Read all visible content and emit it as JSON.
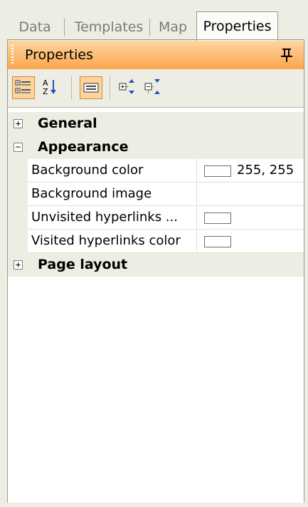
{
  "tabs": [
    {
      "label": "Data"
    },
    {
      "label": "Templates"
    },
    {
      "label": "Map"
    },
    {
      "label": "Properties",
      "active": true
    }
  ],
  "panel": {
    "title": "Properties",
    "pin_icon": "pin-icon",
    "accent_color": "#fba54b"
  },
  "toolbar": {
    "buttons": [
      {
        "name": "categorized-view-button",
        "icon": "categorized-icon",
        "pressed": true
      },
      {
        "name": "alphabetical-sort-button",
        "icon": "sort-az-icon",
        "pressed": false
      },
      {
        "name": "property-pages-button",
        "icon": "property-pages-icon",
        "pressed": true
      },
      {
        "name": "expand-all-button",
        "icon": "expand-all-icon",
        "pressed": false
      },
      {
        "name": "collapse-all-button",
        "icon": "collapse-all-icon",
        "pressed": false
      }
    ]
  },
  "grid": {
    "categories": [
      {
        "label": "General",
        "expanded": false,
        "toggle": "+"
      },
      {
        "label": "Appearance",
        "expanded": true,
        "toggle": "−",
        "properties": [
          {
            "name": "Background color",
            "value": "255, 255",
            "swatch": "#ffffff"
          },
          {
            "name": "Background image",
            "value": ""
          },
          {
            "name": "Unvisited hyperlinks ...",
            "value": "",
            "swatch": "#ffffff"
          },
          {
            "name": "Visited hyperlinks color",
            "value": "",
            "swatch": "#ffffff"
          }
        ]
      },
      {
        "label": "Page layout",
        "expanded": false,
        "toggle": "+"
      }
    ]
  }
}
